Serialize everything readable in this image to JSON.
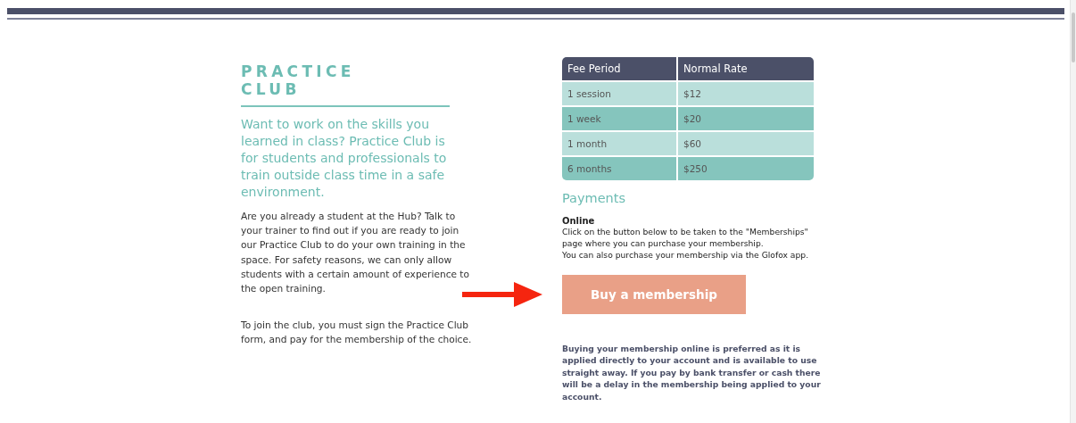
{
  "heading": "PRACTICE CLUB",
  "intro": "Want to work on the skills you learned in class? Practice Club is for students and professionals to train outside class time in a safe environment.",
  "paragraphs": [
    "Are you already a student at the Hub? Talk to your trainer to find out if you are ready to join our Practice Club to do your own training in the space. For safety reasons, we can only allow students with a certain amount of experience to the open training.",
    "To join the club, you must sign the Practice Club form, and pay for the membership of the choice."
  ],
  "fee_table": {
    "columns": [
      "Fee Period",
      "Normal Rate"
    ],
    "rows": [
      [
        "1 session",
        "$12"
      ],
      [
        "1 week",
        "$20"
      ],
      [
        "1 month",
        "$60"
      ],
      [
        "6 months",
        "$250"
      ]
    ]
  },
  "payments": {
    "title": "Payments",
    "subtitle": "Online",
    "lines": [
      "Click on the button below to be taken to the \"Memberships\" page where you can purchase your membership.",
      "You can also purchase your membership via the Glofox app."
    ],
    "button": "Buy a membership",
    "note": "Buying your membership online is preferred as it is applied directly to your account and is available to use straight away.  If you pay by bank transfer or cash there will be a delay in the membership being applied to your account."
  }
}
